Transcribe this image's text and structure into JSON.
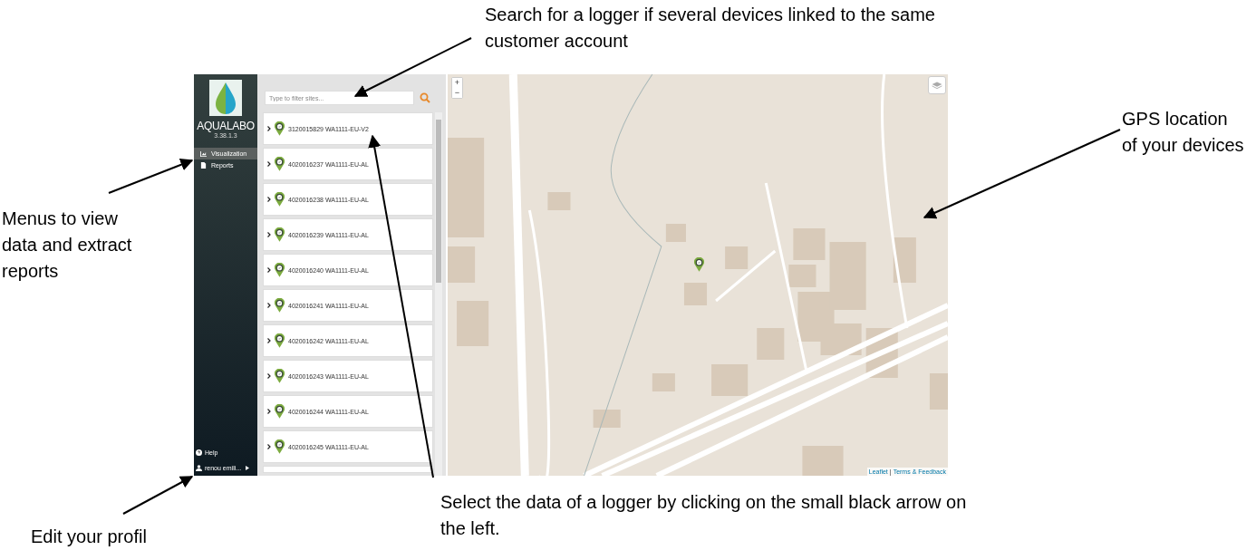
{
  "annotations": [
    {
      "kind": "search",
      "text": "Search for a logger if several devices linked to the same customer account"
    },
    {
      "kind": "gps",
      "text": "GPS location of your devices"
    },
    {
      "kind": "menus",
      "text": "Menus to view data and extract reports"
    },
    {
      "kind": "select",
      "text": "Select the data of a logger by clicking on the small black arrow on the left."
    },
    {
      "kind": "profile",
      "text": "Edit your profil"
    }
  ],
  "sidebar": {
    "brand": "AQUALABO",
    "version": "3.38.1.3",
    "menu": [
      {
        "label": "Visualization",
        "kind": "chart",
        "selected": true
      },
      {
        "label": "Reports",
        "kind": "document",
        "selected": false
      }
    ],
    "footer": [
      {
        "label": "Help",
        "kind": "help"
      },
      {
        "label": "renou emili...",
        "kind": "user"
      }
    ]
  },
  "sites_panel": {
    "filter": {
      "placeholder": "Type to filter sites..."
    },
    "sites": [
      {
        "label": "3120015829 WA1111-EU-V2"
      },
      {
        "label": "4020016237 WA1111-EU-AL"
      },
      {
        "label": "4020016238 WA1111-EU-AL"
      },
      {
        "label": "4020016239 WA1111-EU-AL"
      },
      {
        "label": "4020016240 WA1111-EU-AL"
      },
      {
        "label": "4020016241 WA1111-EU-AL"
      },
      {
        "label": "4020016242 WA1111-EU-AL"
      },
      {
        "label": "4020016243 WA1111-EU-AL"
      },
      {
        "label": "4020016244 WA1111-EU-AL"
      },
      {
        "label": "4020016245 WA1111-EU-AL"
      }
    ]
  },
  "map": {
    "zoom_in": "+",
    "zoom_out": "−",
    "attribution": [
      {
        "text": "Leaflet"
      },
      {
        "text": "Terms & Feedback"
      }
    ],
    "attribution_separator": "|"
  }
}
